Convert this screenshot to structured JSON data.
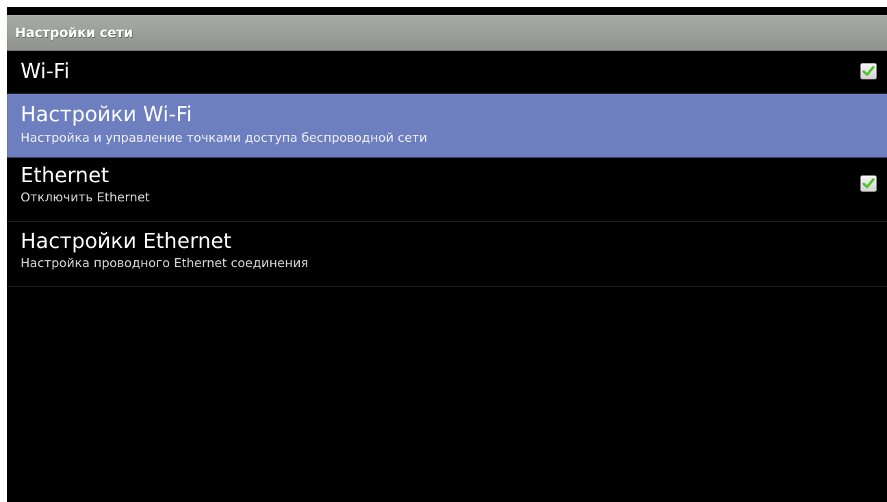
{
  "header": {
    "title": "Настройки сети"
  },
  "items": [
    {
      "title": "Wi-Fi",
      "checkbox": {
        "checked": true,
        "icon": "checkmark-icon"
      }
    },
    {
      "title": "Настройки Wi-Fi",
      "summary": "Настройка и управление точками доступа беспроводной сети",
      "selected": true
    },
    {
      "title": "Ethernet",
      "summary": "Отключить Ethernet",
      "checkbox": {
        "checked": true,
        "icon": "checkmark-icon"
      }
    },
    {
      "title": "Настройки Ethernet",
      "summary": "Настройка проводного Ethernet соединения"
    }
  ],
  "colors": {
    "header_background": "#9ca19a",
    "selected_background": "#6e7fc0",
    "screen_background": "#000000",
    "check_green": "#4cc62a"
  }
}
